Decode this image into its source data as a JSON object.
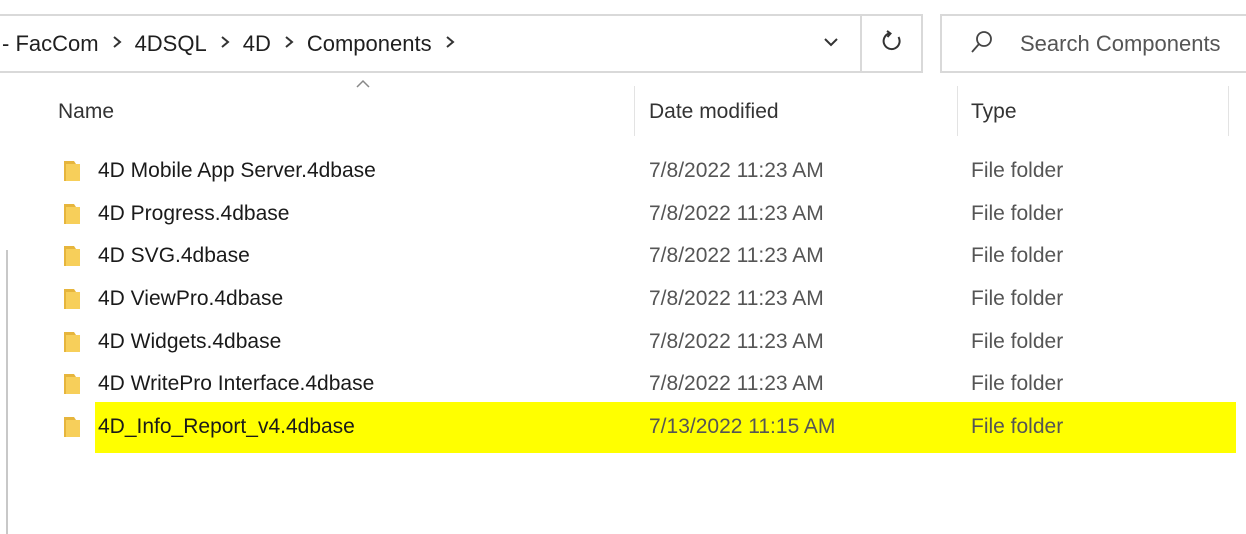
{
  "address": {
    "crumbs": [
      "- FacCom",
      "4DSQL",
      "4D",
      "Components"
    ],
    "separator_icon": "chevron-right-icon",
    "dropdown_icon": "chevron-down-icon",
    "refresh_icon": "refresh-icon"
  },
  "search": {
    "placeholder": "Search Components",
    "value": ""
  },
  "columns": {
    "name": "Name",
    "date": "Date modified",
    "type": "Type",
    "sort_icon": "sort-up-icon"
  },
  "files": [
    {
      "name": "4D Mobile App Server.4dbase",
      "date": "7/8/2022 11:23 AM",
      "type": "File folder"
    },
    {
      "name": "4D Progress.4dbase",
      "date": "7/8/2022 11:23 AM",
      "type": "File folder"
    },
    {
      "name": "4D SVG.4dbase",
      "date": "7/8/2022 11:23 AM",
      "type": "File folder"
    },
    {
      "name": "4D ViewPro.4dbase",
      "date": "7/8/2022 11:23 AM",
      "type": "File folder"
    },
    {
      "name": "4D Widgets.4dbase",
      "date": "7/8/2022 11:23 AM",
      "type": "File folder"
    },
    {
      "name": "4D WritePro Interface.4dbase",
      "date": "7/8/2022 11:23 AM",
      "type": "File folder"
    },
    {
      "name": "4D_Info_Report_v4.4dbase",
      "date": "7/13/2022 11:15 AM",
      "type": "File folder",
      "highlighted": true
    }
  ],
  "colors": {
    "highlight": "#ffff00",
    "folder": "#f2c94c"
  }
}
